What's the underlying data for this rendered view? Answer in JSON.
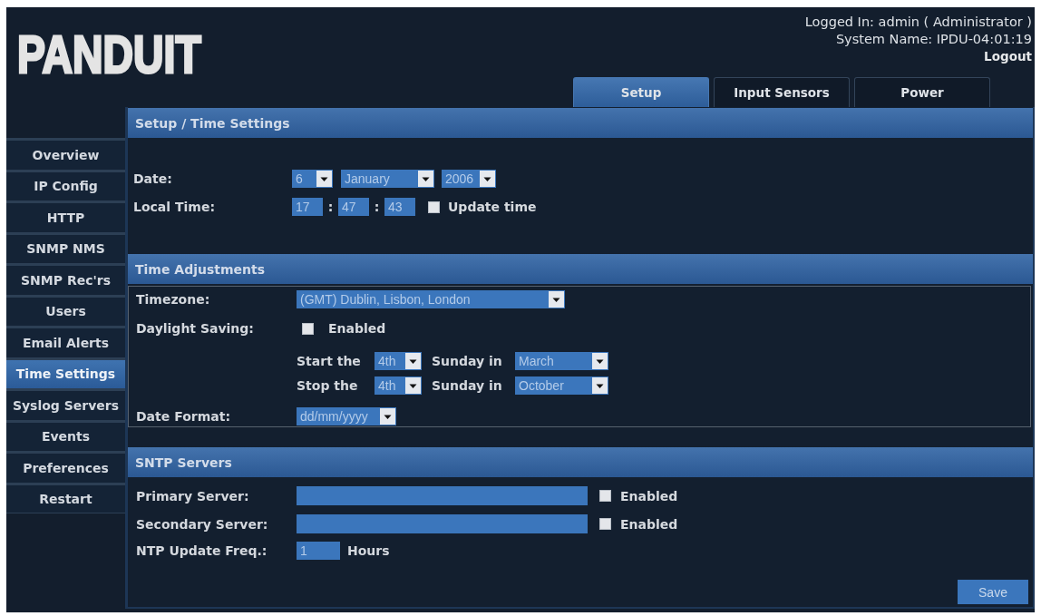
{
  "header": {
    "logo": "PANDUIT",
    "logged_in": "Logged In: admin ( Administrator )",
    "system_name": "System Name: IPDU-04:01:19",
    "logout": "Logout"
  },
  "tabs": [
    {
      "label": "Setup",
      "selected": true
    },
    {
      "label": "Input Sensors",
      "selected": false
    },
    {
      "label": "Power",
      "selected": false
    }
  ],
  "sidebar": [
    {
      "label": "Overview",
      "selected": false
    },
    {
      "label": "IP Config",
      "selected": false
    },
    {
      "label": "HTTP",
      "selected": false
    },
    {
      "label": "SNMP NMS",
      "selected": false
    },
    {
      "label": "SNMP Rec'rs",
      "selected": false
    },
    {
      "label": "Users",
      "selected": false
    },
    {
      "label": "Email Alerts",
      "selected": false
    },
    {
      "label": "Time Settings",
      "selected": true
    },
    {
      "label": "Syslog Servers",
      "selected": false
    },
    {
      "label": "Events",
      "selected": false
    },
    {
      "label": "Preferences",
      "selected": false
    },
    {
      "label": "Restart",
      "selected": false
    }
  ],
  "setup": {
    "title": "Setup / Time Settings",
    "date": {
      "label": "Date:",
      "day": "6",
      "month": "January",
      "year": "2006"
    },
    "local_time": {
      "label": "Local Time:",
      "hours": "17",
      "minutes": "47",
      "seconds": "43",
      "separators": [
        ":",
        ":"
      ],
      "update": {
        "label": "Update time",
        "checked": false
      }
    }
  },
  "time_adjustments": {
    "title": "Time Adjustments",
    "timezone": {
      "label": "Timezone:",
      "value": "(GMT) Dublin, Lisbon, London"
    },
    "daylight_saving": {
      "label": "Daylight Saving:",
      "checkbox": {
        "label": "Enabled",
        "checked": false
      }
    },
    "rules": [
      {
        "label": "Start the",
        "week": "4th",
        "day_label": "Sunday in",
        "month": "March"
      },
      {
        "label": "Stop the",
        "week": "4th",
        "day_label": "Sunday in",
        "month": "October"
      }
    ],
    "date_format": {
      "label": "Date Format:",
      "value": "dd/mm/yyyy"
    }
  },
  "sntp": {
    "title": "SNTP Servers",
    "servers": [
      {
        "label": "Primary Server:",
        "enabled": {
          "label": "Enabled",
          "checked": false
        }
      },
      {
        "label": "Secondary Server:",
        "enabled": {
          "label": "Enabled",
          "checked": false
        }
      }
    ],
    "update_freq": {
      "label": "NTP Update Freq.:",
      "value": "1",
      "unit": "Hours"
    }
  },
  "save_button": "Save"
}
